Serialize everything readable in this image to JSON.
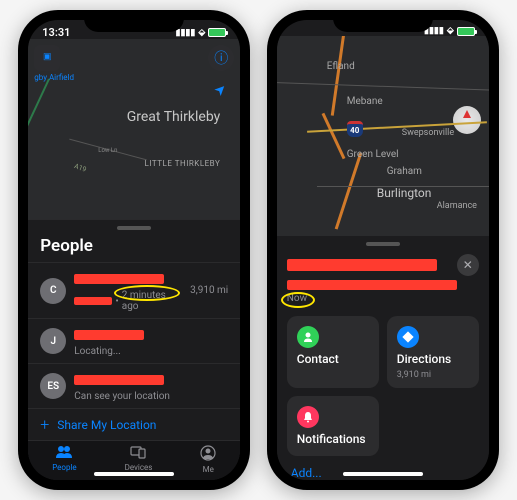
{
  "left": {
    "status": {
      "time": "13:31",
      "arrow": "↖"
    },
    "map": {
      "location_hint": "gby Airfield",
      "labels": {
        "main": "Great Thirkleby",
        "small": "LITTLE THIRKLEBY",
        "road": "A19",
        "lane": "Low Ln"
      }
    },
    "sheet_title": "People",
    "people": [
      {
        "initials": "C",
        "time_ago": "2 minutes ago",
        "distance": "3,910 mi"
      },
      {
        "initials": "J",
        "status": "Locating..."
      },
      {
        "initials": "ES",
        "status": "Can see your location"
      }
    ],
    "share_label": "Share My Location",
    "tabs": {
      "people": "People",
      "devices": "Devices",
      "me": "Me"
    }
  },
  "right": {
    "map": {
      "labels": {
        "efland": "Efland",
        "mebane": "Mebane",
        "swepsonville": "Swepsonville",
        "greenlevel": "Green Level",
        "graham": "Graham",
        "burlington": "Burlington",
        "alamance": "Alamance"
      },
      "interstate": "40"
    },
    "detail": {
      "now_label": "Now",
      "tiles": {
        "contact": "Contact",
        "directions": "Directions",
        "directions_sub": "3,910 mi",
        "notifications": "Notifications"
      },
      "add": "Add..."
    }
  },
  "icons": {
    "info": "ⓘ",
    "nav_arrow": "➤",
    "plus": "+",
    "close": "✕",
    "people": "👥",
    "devices": "▮",
    "me": "◉",
    "contact": "✆",
    "directions": "◈",
    "bell": "●"
  }
}
